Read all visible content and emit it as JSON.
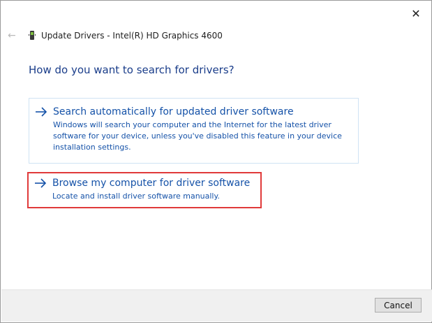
{
  "window": {
    "title": "Update Drivers - Intel(R) HD Graphics 4600"
  },
  "icons": {
    "close": "close-icon",
    "back": "back-arrow-icon",
    "device": "display-adapter-icon",
    "option_arrow": "arrow-right-icon"
  },
  "main": {
    "heading": "How do you want to search for drivers?",
    "options": [
      {
        "title": "Search automatically for updated driver software",
        "description": "Windows will search your computer and the Internet for the latest driver software for your device, unless you've disabled this feature in your device installation settings."
      },
      {
        "title": "Browse my computer for driver software",
        "description": "Locate and install driver software manually."
      }
    ]
  },
  "footer": {
    "cancel_label": "Cancel"
  },
  "colors": {
    "link": "#1552a8",
    "heading": "#1a3d8a",
    "highlight": "#e03a3a"
  }
}
